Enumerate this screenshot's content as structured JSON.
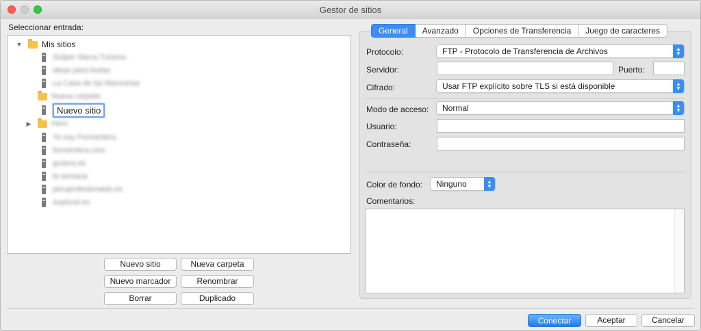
{
  "window": {
    "title": "Gestor de sitios"
  },
  "left": {
    "select_label": "Seleccionar entrada:",
    "tree": {
      "root": "Mis sitios",
      "items": [
        {
          "label": "Golper Sierra Turismo",
          "type": "server"
        },
        {
          "label": "ideas para bodas",
          "type": "server"
        },
        {
          "label": "La Casa de las Manzanas",
          "type": "server"
        },
        {
          "label": "Nueva carpeta",
          "type": "folder"
        },
        {
          "label": "Nuevo sitio",
          "type": "server",
          "editing": true
        },
        {
          "label": "Hero",
          "type": "folder"
        },
        {
          "label": "Yo soy Formentera",
          "type": "server"
        },
        {
          "label": "formentera.com",
          "type": "server"
        },
        {
          "label": "gosera.es",
          "type": "server"
        },
        {
          "label": "la semana",
          "type": "server"
        },
        {
          "label": "peruprofesionweb.es",
          "type": "server"
        },
        {
          "label": "soylocal.es",
          "type": "server"
        }
      ]
    },
    "buttons": {
      "new_site": "Nuevo sitio",
      "new_folder": "Nueva carpeta",
      "new_bookmark": "Nuevo marcador",
      "rename": "Renombrar",
      "delete": "Borrar",
      "duplicate": "Duplicado"
    }
  },
  "tabs": [
    "General",
    "Avanzado",
    "Opciones de Transferencia",
    "Juego de caracteres"
  ],
  "active_tab": "General",
  "form": {
    "protocol_label": "Protocolo:",
    "protocol_value": "FTP - Protocolo de Transferencia de Archivos",
    "server_label": "Servidor:",
    "server_value": "",
    "port_label": "Puerto:",
    "port_value": "",
    "encryption_label": "Cifrado:",
    "encryption_value": "Usar FTP explícito sobre TLS si está disponible",
    "access_mode_label": "Modo de acceso:",
    "access_mode_value": "Normal",
    "user_label": "Usuario:",
    "user_value": "",
    "password_label": "Contraseña:",
    "password_value": "",
    "bg_color_label": "Color de fondo:",
    "bg_color_value": "Ninguno",
    "comments_label": "Comentarios:",
    "comments_value": ""
  },
  "footer": {
    "connect": "Conectar",
    "accept": "Aceptar",
    "cancel": "Cancelar"
  },
  "colors": {
    "accent": "#3b8cf3",
    "folder": "#f5c24a"
  }
}
